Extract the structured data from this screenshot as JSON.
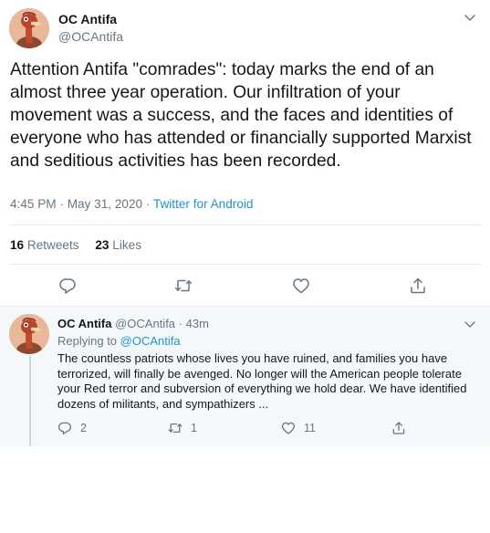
{
  "main_tweet": {
    "display_name": "OC Antifa",
    "handle": "@OCAntifa",
    "text": "Attention Antifa \"comrades\": today marks the end of an almost three year operation. Our infiltration of your movement was a success, and the faces and identities of everyone who has attended or financially supported Marxist and seditious activities has been recorded.",
    "timestamp": "4:45 PM · May 31, 2020 · ",
    "source": "Twitter for Android",
    "retweet_count": "16",
    "retweet_label": "Retweets",
    "like_count": "23",
    "like_label": "Likes"
  },
  "reply_tweet": {
    "display_name": "OC Antifa",
    "handle": "@OCAntifa",
    "time": "· 43m",
    "replying_prefix": "Replying to ",
    "replying_to": "@OCAntifa",
    "text": "The countless patriots whose lives you have ruined, and families you have terrorized, will finally be avenged. No longer will the American people tolerate your Red terror and subversion of everything we hold dear. We have identified dozens of militants,  and sympathizers ...",
    "reply_count": "2",
    "retweet_count": "1",
    "like_count": "11"
  },
  "icons": {
    "caret": "chevron-down-icon",
    "reply": "reply-icon",
    "retweet": "retweet-icon",
    "like": "heart-icon",
    "share": "share-icon",
    "avatar": "ostrich-avatar"
  },
  "colors": {
    "link": "#1b95e0",
    "secondary_text": "#657786",
    "primary_text": "#14171a",
    "reply_background": "#f5f8fa"
  }
}
